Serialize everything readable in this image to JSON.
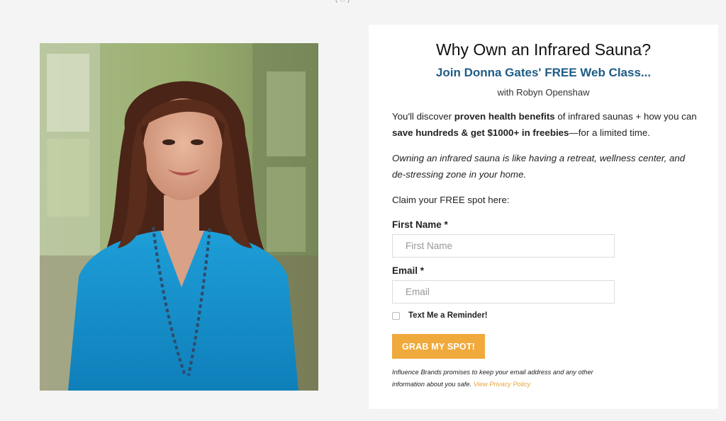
{
  "top_fragment": "( … )",
  "card": {
    "headline": "Why Own an Infrared Sauna?",
    "subhead": "Join Donna Gates' FREE Web Class...",
    "byline": "with Robyn Openshaw",
    "intro": {
      "part1": "You'll discover ",
      "bold1": "proven health benefits",
      "part2": " of infrared saunas + how you can ",
      "bold2": "save hundreds & get $1000+ in freebies",
      "part3": "—for a limited time."
    },
    "italic_para": "Owning an infrared sauna is like having a retreat, wellness center, and de-stressing zone in your home.",
    "claim": "Claim your FREE spot here:"
  },
  "form": {
    "first_name_label": "First Name *",
    "first_name_placeholder": "First Name",
    "first_name_value": "",
    "email_label": "Email *",
    "email_placeholder": "Email",
    "email_value": "",
    "reminder_label": "Text Me a Reminder!",
    "reminder_checked": false,
    "submit_label": "GRAB MY SPOT!"
  },
  "privacy": {
    "text": "Influence Brands promises to keep your email address and any other information about you safe. ",
    "link": "View Privacy Policy"
  },
  "colors": {
    "subhead": "#1f5c86",
    "button": "#f0a93b",
    "link": "#e8a33a",
    "page_bg": "#f4f4f4"
  }
}
